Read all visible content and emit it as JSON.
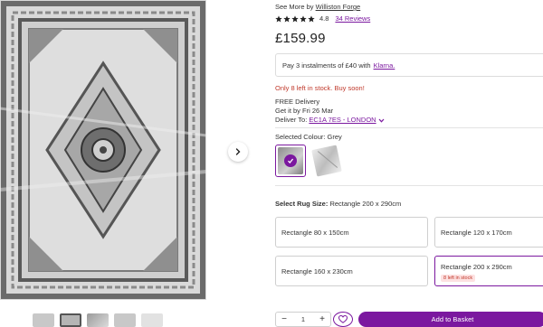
{
  "product": {
    "see_more_prefix": "See More by",
    "brand": "Williston Forge",
    "rating_value": "4.8",
    "star_count": 5,
    "reviews_text": "34 Reviews",
    "price": "£159.99",
    "klarna_text": "Pay 3 instalments of £40 with",
    "klarna_link": "Klarna.",
    "stock_warning": "Only 8 left in stock. Buy soon!",
    "delivery_line1": "FREE Delivery",
    "delivery_line2": "Get it by Fri 26 Mar",
    "deliver_to_prefix": "Deliver To:",
    "deliver_to_postcode": "EC1A 7ES - LONDON"
  },
  "colour": {
    "label": "Selected Colour: Grey",
    "swatches": [
      {
        "name": "Grey",
        "selected": true
      },
      {
        "name": "Cream",
        "selected": false
      }
    ]
  },
  "size": {
    "label_bold": "Select Rug Size:",
    "label_value": "Rectangle 200 x 290cm",
    "options": [
      {
        "label": "Rectangle 80 x 150cm",
        "selected": false
      },
      {
        "label": "Rectangle 120 x 170cm",
        "selected": false
      },
      {
        "label": "Rectangle 160 x 230cm",
        "selected": false
      },
      {
        "label": "Rectangle 200 x 290cm",
        "selected": true,
        "badge": "8 left in stock"
      }
    ]
  },
  "cart": {
    "quantity": "1",
    "minus": "−",
    "plus": "+",
    "add_to_basket": "Add to Basket"
  },
  "colors": {
    "accent": "#7b189f",
    "warning": "#c0392b",
    "badge_bg": "#fde1e1"
  },
  "icons": [
    "chevron-right-icon",
    "star-icon",
    "chevron-down-icon",
    "check-icon",
    "heart-icon"
  ]
}
